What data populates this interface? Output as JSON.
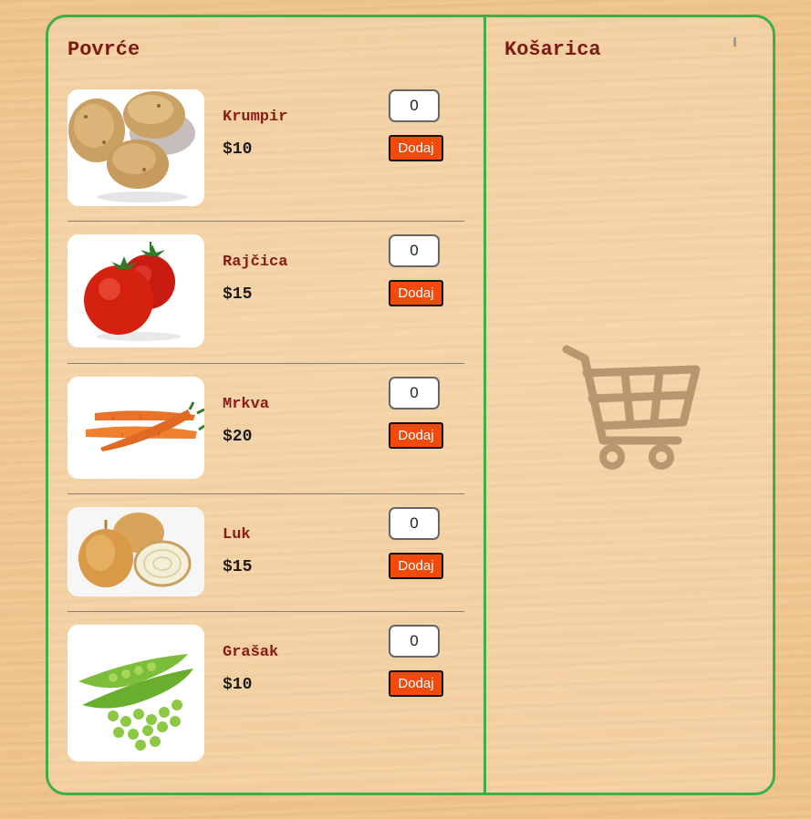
{
  "products_panel": {
    "title": "Povrće",
    "items": [
      {
        "name": "Krumpir",
        "price": "$10",
        "qty": "0",
        "add_label": "Dodaj",
        "image": "potato-image"
      },
      {
        "name": "Rajčica",
        "price": "$15",
        "qty": "0",
        "add_label": "Dodaj",
        "image": "tomato-image"
      },
      {
        "name": "Mrkva",
        "price": "$20",
        "qty": "0",
        "add_label": "Dodaj",
        "image": "carrot-image"
      },
      {
        "name": "Luk",
        "price": "$15",
        "qty": "0",
        "add_label": "Dodaj",
        "image": "onion-image"
      },
      {
        "name": "Grašak",
        "price": "$10",
        "qty": "0",
        "add_label": "Dodaj",
        "image": "peas-image"
      }
    ]
  },
  "cart_panel": {
    "title": "Košarica",
    "icon": "shopping-cart-icon"
  },
  "colors": {
    "border_green": "#3fae46",
    "title_red": "#7a1a12",
    "button_orange": "#f24a0a",
    "cart_icon": "#b08c66"
  }
}
